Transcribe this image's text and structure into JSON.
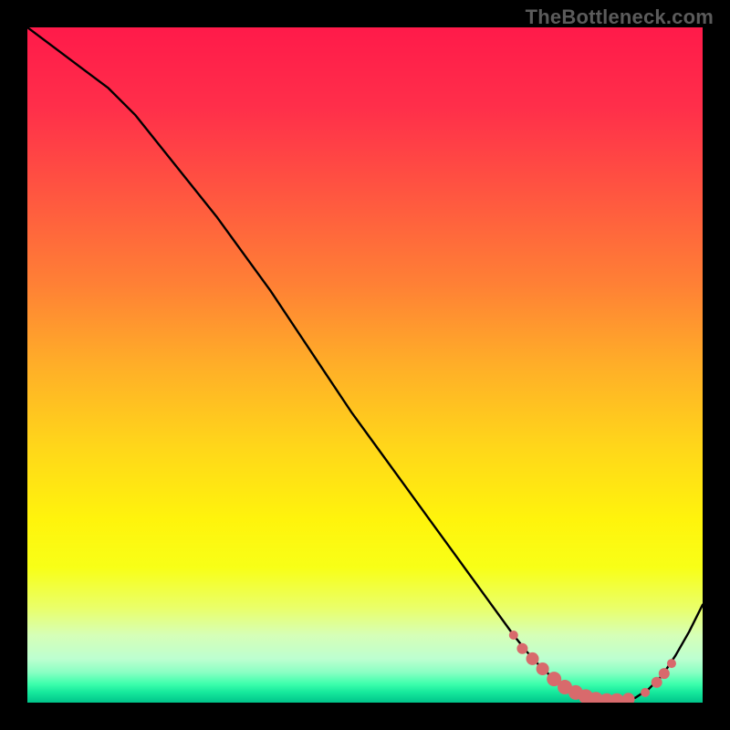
{
  "watermark": "TheBottleneck.com",
  "colors": {
    "gradient_stops": [
      {
        "offset": 0.0,
        "color": "#ff1a4a"
      },
      {
        "offset": 0.12,
        "color": "#ff2f4a"
      },
      {
        "offset": 0.25,
        "color": "#ff5740"
      },
      {
        "offset": 0.38,
        "color": "#ff8035"
      },
      {
        "offset": 0.5,
        "color": "#ffae28"
      },
      {
        "offset": 0.62,
        "color": "#ffd61a"
      },
      {
        "offset": 0.73,
        "color": "#fff40c"
      },
      {
        "offset": 0.8,
        "color": "#f8ff17"
      },
      {
        "offset": 0.86,
        "color": "#eaff6a"
      },
      {
        "offset": 0.9,
        "color": "#d6ffb7"
      },
      {
        "offset": 0.935,
        "color": "#bdffd0"
      },
      {
        "offset": 0.955,
        "color": "#8affc3"
      },
      {
        "offset": 0.972,
        "color": "#3effad"
      },
      {
        "offset": 0.985,
        "color": "#15e89c"
      },
      {
        "offset": 1.0,
        "color": "#00c48a"
      }
    ],
    "curve": "#000000",
    "marker_fill": "#d86a6c",
    "marker_stroke": "#d86a6c"
  },
  "chart_data": {
    "type": "line",
    "title": "",
    "xlabel": "",
    "ylabel": "",
    "xlim": [
      0,
      100
    ],
    "ylim": [
      0,
      100
    ],
    "grid": false,
    "series": [
      {
        "name": "bottleneck-curve",
        "x": [
          0,
          4,
          8,
          12,
          16,
          20,
          24,
          28,
          32,
          36,
          40,
          44,
          48,
          52,
          56,
          60,
          64,
          68,
          72,
          74,
          76,
          78,
          80,
          82,
          84,
          86,
          88,
          90,
          92,
          94,
          96,
          98,
          100
        ],
        "y": [
          100,
          97,
          94,
          91,
          87,
          82,
          77,
          72,
          66.5,
          61,
          55,
          49,
          43,
          37.5,
          32,
          26.5,
          21,
          15.5,
          10,
          7.5,
          5.3,
          3.5,
          2.0,
          1.0,
          0.5,
          0.3,
          0.3,
          0.7,
          2.0,
          4.0,
          7.0,
          10.5,
          14.5
        ]
      }
    ],
    "markers": {
      "name": "highlight-dots",
      "points": [
        {
          "x": 72.0,
          "y": 10.0,
          "r": 5
        },
        {
          "x": 73.3,
          "y": 8.0,
          "r": 6
        },
        {
          "x": 74.8,
          "y": 6.5,
          "r": 7
        },
        {
          "x": 76.3,
          "y": 5.0,
          "r": 7
        },
        {
          "x": 78.0,
          "y": 3.5,
          "r": 8
        },
        {
          "x": 79.6,
          "y": 2.3,
          "r": 8
        },
        {
          "x": 81.2,
          "y": 1.5,
          "r": 8
        },
        {
          "x": 82.7,
          "y": 0.9,
          "r": 8
        },
        {
          "x": 84.2,
          "y": 0.5,
          "r": 8
        },
        {
          "x": 85.8,
          "y": 0.3,
          "r": 8
        },
        {
          "x": 87.3,
          "y": 0.3,
          "r": 8
        },
        {
          "x": 89.0,
          "y": 0.5,
          "r": 7
        },
        {
          "x": 91.5,
          "y": 1.5,
          "r": 5
        },
        {
          "x": 93.2,
          "y": 3.0,
          "r": 6
        },
        {
          "x": 94.3,
          "y": 4.3,
          "r": 6
        },
        {
          "x": 95.4,
          "y": 5.8,
          "r": 5
        }
      ]
    }
  }
}
